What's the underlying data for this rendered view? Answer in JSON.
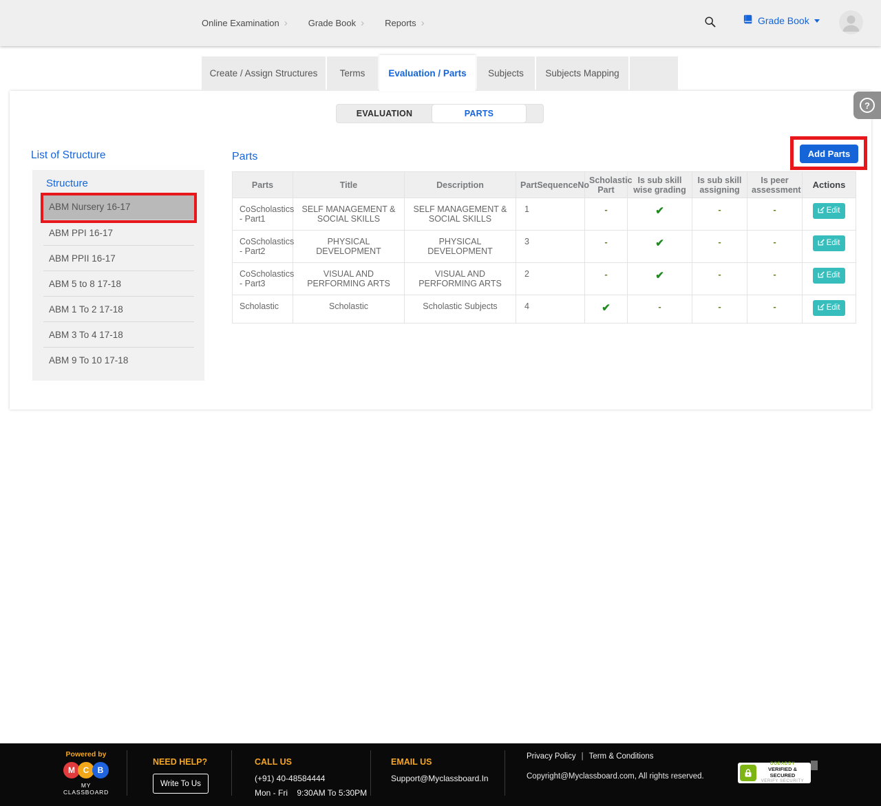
{
  "header": {
    "nav": [
      "Online Examination",
      "Grade Book",
      "Reports"
    ],
    "module_switcher": "Grade Book"
  },
  "tabs": {
    "items": [
      "Create / Assign Structures",
      "Terms",
      "Evaluation / Parts",
      "Subjects",
      "Subjects Mapping"
    ],
    "active": "Evaluation / Parts"
  },
  "segmented": {
    "evaluation": "EVALUATION",
    "parts": "PARTS",
    "active": "PARTS"
  },
  "help": {
    "label": "?"
  },
  "structure": {
    "section_title": "List of Structure",
    "panel_title": "Structure",
    "selected": "ABM Nursery 16-17",
    "items": [
      "ABM Nursery 16-17",
      "ABM PPI 16-17",
      "ABM PPII 16-17",
      "ABM 5 to 8 17-18",
      "ABM 1 To 2 17-18",
      "ABM 3 To 4 17-18",
      "ABM 9 To 10 17-18"
    ]
  },
  "parts": {
    "section_title": "Parts",
    "add_button_label": "Add Parts"
  },
  "table": {
    "headers": [
      "Parts",
      "Title",
      "Description",
      "PartSequenceNo",
      "Scholastic Part",
      "Is sub skill wise grading",
      "Is sub skill assigning",
      "Is peer assessment",
      "Actions"
    ],
    "edit_label": "Edit",
    "rows": [
      {
        "parts": "CoScholastics - Part1",
        "title": "SELF MANAGEMENT & SOCIAL SKILLS",
        "description": "SELF MANAGEMENT & SOCIAL SKILLS",
        "part_sequence_no": "1",
        "scholastic_part": "-",
        "is_sub_skill_wise_grading": "✔",
        "is_sub_skill_assigning": "-",
        "is_peer_assessment": "-"
      },
      {
        "parts": "CoScholastics - Part2",
        "title": "PHYSICAL DEVELOPMENT",
        "description": "PHYSICAL DEVELOPMENT",
        "part_sequence_no": "3",
        "scholastic_part": "-",
        "is_sub_skill_wise_grading": "✔",
        "is_sub_skill_assigning": "-",
        "is_peer_assessment": "-"
      },
      {
        "parts": "CoScholastics - Part3",
        "title": "VISUAL AND PERFORMING ARTS",
        "description": "VISUAL AND PERFORMING ARTS",
        "part_sequence_no": "2",
        "scholastic_part": "-",
        "is_sub_skill_wise_grading": "✔",
        "is_sub_skill_assigning": "-",
        "is_peer_assessment": "-"
      },
      {
        "parts": "Scholastic",
        "title": "Scholastic",
        "description": "Scholastic Subjects",
        "part_sequence_no": "4",
        "scholastic_part": "✔",
        "is_sub_skill_wise_grading": "-",
        "is_sub_skill_assigning": "-",
        "is_peer_assessment": "-"
      }
    ]
  },
  "footer": {
    "powered_by": "Powered by",
    "brand_letters": [
      "M",
      "C",
      "B"
    ],
    "brand_name": "MY CLASSBOARD",
    "need_help": {
      "title": "NEED HELP?",
      "button": "Write To Us"
    },
    "call_us": {
      "title": "CALL US",
      "phone": "(+91) 40-48584444",
      "hours": "Mon - Fri    9:30AM To 5:30PM"
    },
    "email_us": {
      "title": "EMAIL US",
      "email": "Support@Myclassboard.In"
    },
    "legal": {
      "privacy": "Privacy Policy",
      "separator": "|",
      "terms": "Term & Conditions",
      "copyright": "Copyright@Myclassboard.com, All rights reserved."
    },
    "badge": {
      "brand": "GODADDY",
      "line1": "VERIFIED & SECURED",
      "line2": "VERIFY SECURITY"
    }
  },
  "colors": {
    "accent_blue": "#1565D8",
    "annotation_red": "#E8171B",
    "edit_teal": "#38BDBD",
    "check_green": "#1F8A1F",
    "footer_orange": "#F5A623",
    "selected_gray": "#B9B9B9"
  }
}
